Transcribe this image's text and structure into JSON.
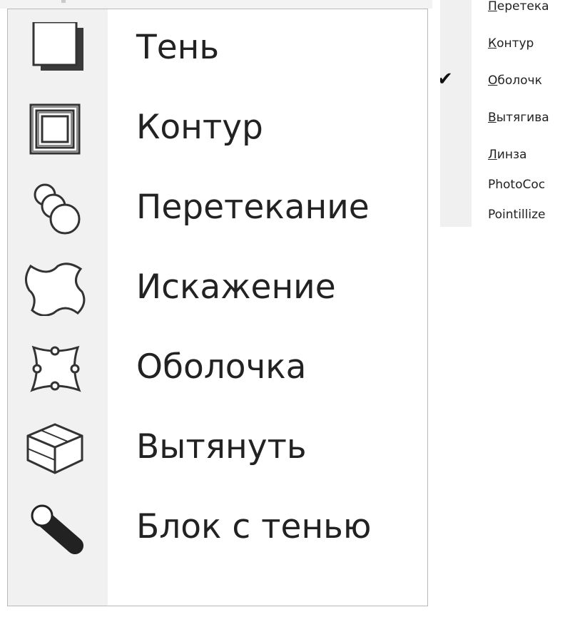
{
  "big_menu": {
    "items": [
      {
        "label": "Тень",
        "icon": "drop-shadow-icon"
      },
      {
        "label": "Контур",
        "icon": "contour-icon"
      },
      {
        "label": "Перетекание",
        "icon": "blend-icon"
      },
      {
        "label": "Искажение",
        "icon": "distort-icon"
      },
      {
        "label": "Оболочка",
        "icon": "envelope-icon"
      },
      {
        "label": "Вытянуть",
        "icon": "extrude-icon"
      },
      {
        "label": "Блок с тенью",
        "icon": "block-shadow-icon"
      }
    ]
  },
  "small_menu": {
    "items": [
      {
        "first": "П",
        "rest": "еретека",
        "checked": false
      },
      {
        "first": "К",
        "rest": "онтур",
        "checked": false
      },
      {
        "first": "О",
        "rest": "болочк",
        "checked": true
      },
      {
        "first": "В",
        "rest": "ытягива",
        "checked": false
      },
      {
        "first": "Л",
        "rest": "инза",
        "checked": false
      },
      {
        "first": "",
        "rest": "PhotoCoc",
        "checked": false
      },
      {
        "first": "",
        "rest": "Pointillize",
        "checked": false
      }
    ],
    "check_glyph": "✔"
  }
}
